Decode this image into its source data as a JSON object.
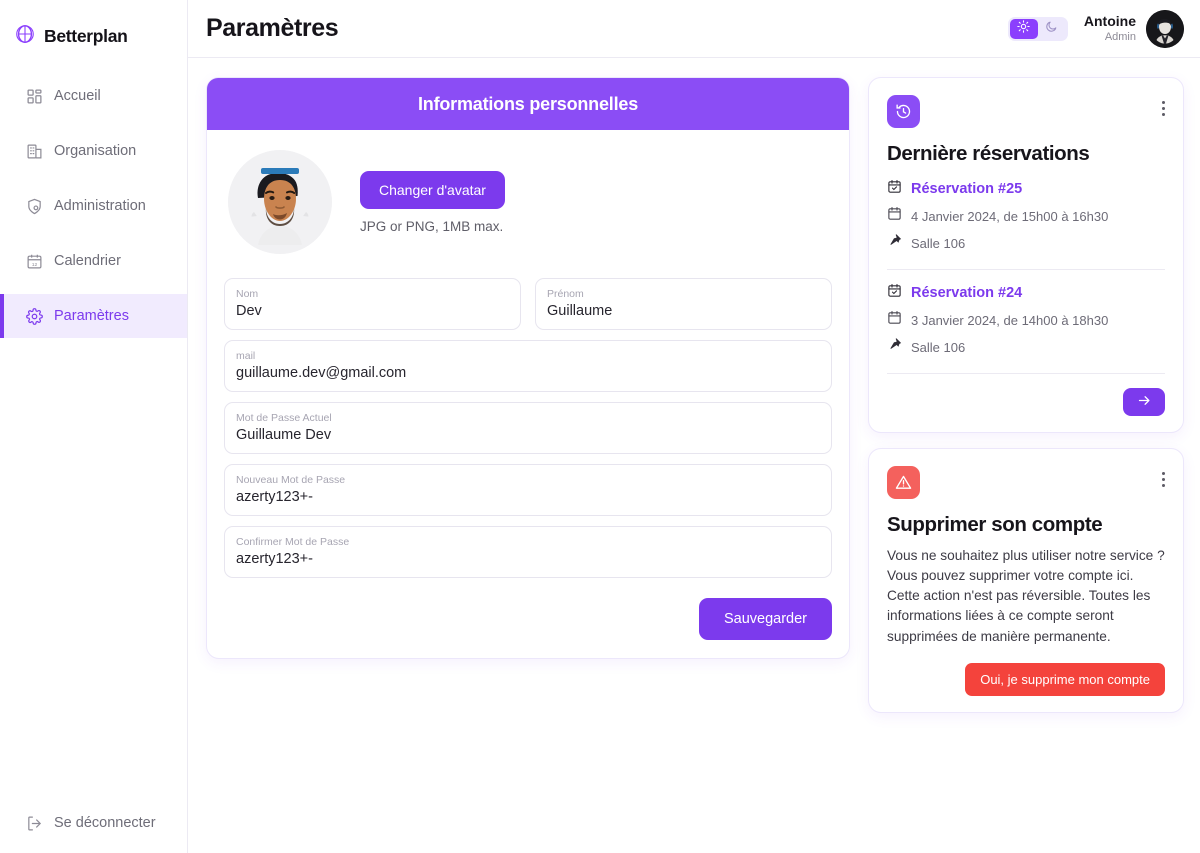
{
  "brand": {
    "name": "Betterplan",
    "logo_icon": "betterplan-logo-icon",
    "color": "#8b3ffd"
  },
  "sidebar": {
    "items": [
      {
        "label": "Accueil",
        "icon": "grid-icon",
        "active": false
      },
      {
        "label": "Organisation",
        "icon": "building-icon",
        "active": false
      },
      {
        "label": "Administration",
        "icon": "shield-user-icon",
        "active": false
      },
      {
        "label": "Calendrier",
        "icon": "calendar-icon",
        "active": false
      },
      {
        "label": "Paramètres",
        "icon": "gear-icon",
        "active": true
      }
    ],
    "logout": {
      "label": "Se déconnecter",
      "icon": "logout-icon"
    }
  },
  "header": {
    "title": "Paramètres",
    "theme": {
      "light_icon": "sun-icon",
      "dark_icon": "moon-icon",
      "active": "light"
    },
    "user": {
      "name": "Antoine",
      "role": "Admin",
      "avatar": "user-avatar"
    }
  },
  "personal_info": {
    "card_title": "Informations personnelles",
    "avatar_alt": "profile-photo",
    "change_avatar_label": "Changer d'avatar",
    "avatar_hint": "JPG or PNG, 1MB max.",
    "fields": [
      {
        "label": "Nom",
        "value": "Dev"
      },
      {
        "label": "Prénom",
        "value": "Guillaume"
      },
      {
        "label": "mail",
        "value": "guillaume.dev@gmail.com"
      },
      {
        "label": "Mot de Passe Actuel",
        "value": "Guillaume Dev"
      },
      {
        "label": "Nouveau Mot de Passe",
        "value": "azerty123+-"
      },
      {
        "label": "Confirmer Mot de Passe",
        "value": "azerty123+-"
      }
    ],
    "save_label": "Sauvegarder"
  },
  "reservations_card": {
    "icon": "history-icon",
    "title": "Dernière réservations",
    "items": [
      {
        "name": "Réservation #25",
        "date": "4 Janvier 2024, de 15h00 à 16h30",
        "room": "Salle 106"
      },
      {
        "name": "Réservation #24",
        "date": "3 Janvier 2024, de 14h00 à 18h30",
        "room": "Salle 106"
      }
    ],
    "arrow_label": "→"
  },
  "delete_card": {
    "icon": "warning-icon",
    "title": "Supprimer son compte",
    "body": "Vous ne souhaitez plus utiliser notre service ? Vous pouvez supprimer votre compte ici. Cette action n'est pas réversible. Toutes les informations liées à ce compte seront supprimées de manière permanente.",
    "button_label": "Oui, je supprime mon compte",
    "button_color": "#f4433c"
  }
}
